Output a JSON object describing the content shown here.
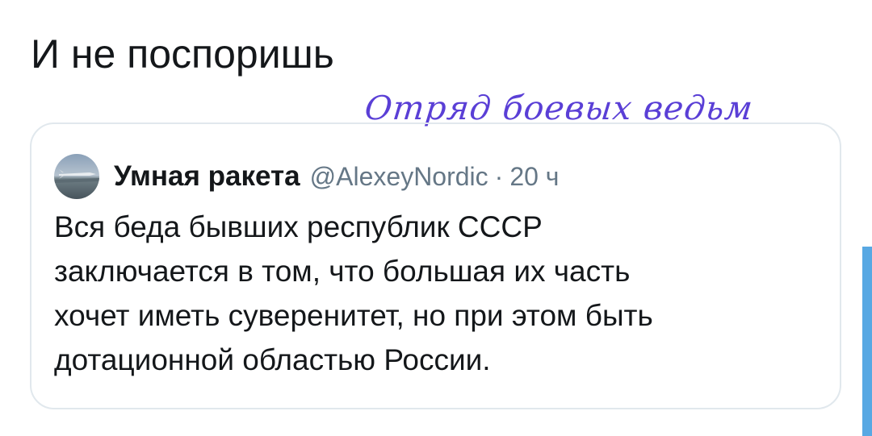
{
  "tweet": {
    "text": "И не поспоришь"
  },
  "watermark": {
    "text": "Отряд боевых ведьм",
    "color": "#5a3fd6"
  },
  "quoted_tweet": {
    "author_name": "Умная ракета",
    "author_handle": "@AlexeyNordic",
    "separator": "·",
    "time": "20 ч",
    "avatar_icon": "missile-avatar",
    "body_lines": [
      "Вся беда бывших республик СССР",
      "заключается в том, что большая их часть",
      "хочет иметь суверенитет, но при этом быть",
      "дотационной областью России."
    ]
  },
  "colors": {
    "text_primary": "#14171a",
    "text_secondary": "#657786",
    "card_border": "#e1e8ed",
    "accent": "#58a8e3"
  }
}
